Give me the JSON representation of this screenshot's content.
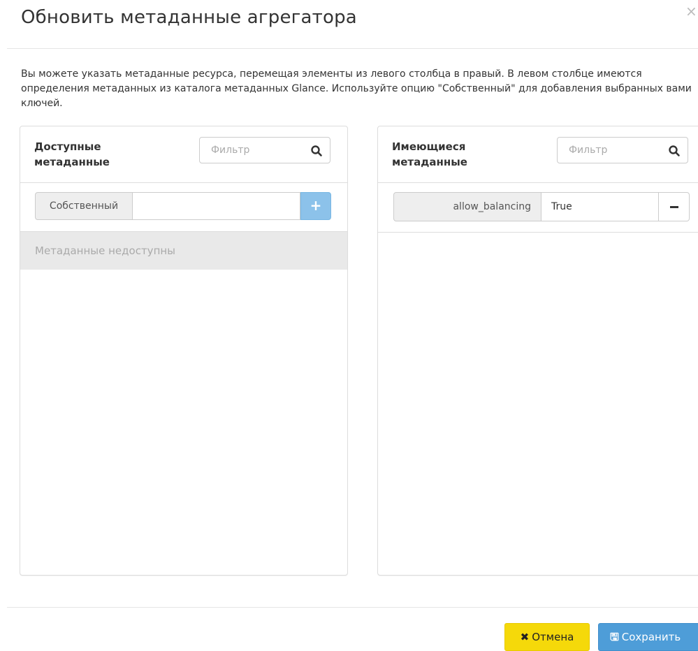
{
  "modal": {
    "title": "Обновить метаданные агрегатора",
    "close_glyph": "×",
    "description": "Вы можете указать метаданные ресурса, перемещая элементы из левого столбца в правый. В левом столбце имеются определения метаданных из каталога метаданных Glance. Используйте опцию \"Собственный\" для добавления выбранных вами ключей."
  },
  "available": {
    "title": "Доступные метаданные",
    "filter_placeholder": "Фильтр",
    "custom_label": "Собственный",
    "custom_value": "",
    "add_glyph": "+",
    "empty_text": "Метаданные недоступны"
  },
  "existing": {
    "title": "Имеющиеся метаданные",
    "filter_placeholder": "Фильтр",
    "items": [
      {
        "key": "allow_balancing",
        "value": "True"
      }
    ]
  },
  "footer": {
    "cancel_icon": "✖",
    "cancel_label": "Отмена",
    "save_icon": "🖫",
    "save_label": "Сохранить"
  },
  "colors": {
    "cancel_bg": "#f5d90a",
    "save_bg": "#4e9dd8",
    "add_bg": "#8cc2ea"
  }
}
